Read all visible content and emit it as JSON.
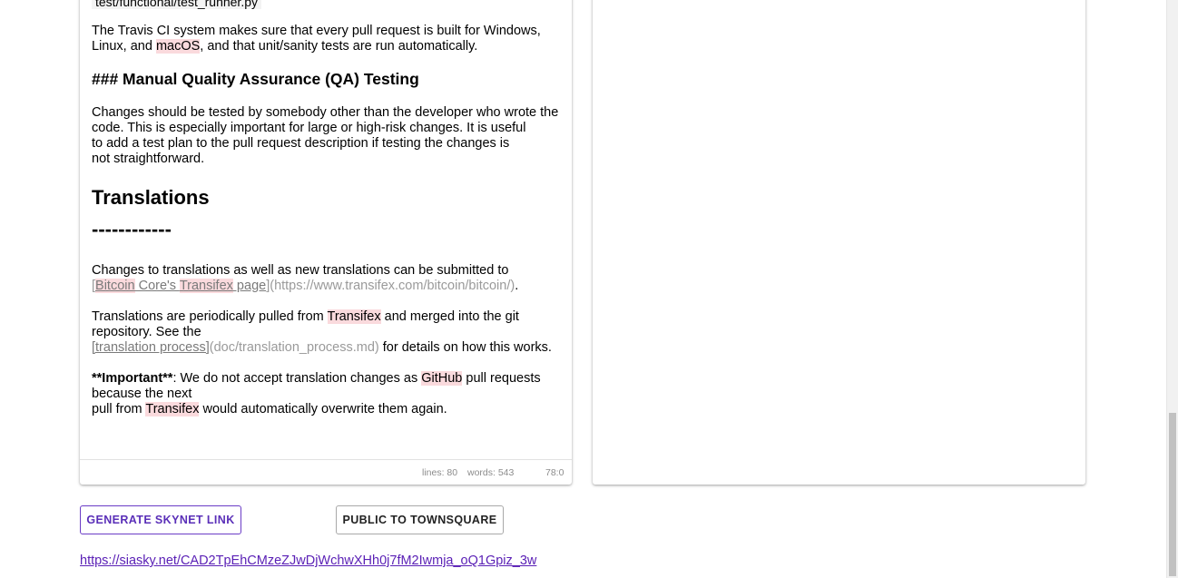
{
  "editor": {
    "code_line": "test/functional/test_runner.py",
    "travis_para": {
      "line1": "The Travis CI system makes sure that every pull request is built for Windows,",
      "line2_a": "Linux, and ",
      "line2_mis": "macOS",
      "line2_b": ", and that unit/sanity tests are run automatically."
    },
    "qa_heading": "### Manual Quality Assurance (QA) Testing",
    "qa_para": [
      "Changes should be tested by somebody other than the developer who wrote the",
      "code. This is especially important for large or high-risk changes. It is useful",
      "to add a test plan to the pull request description if testing the changes is",
      "not straightforward."
    ],
    "translations_heading": "Translations",
    "translations_rule": "------------",
    "trans_para1": {
      "line1": "Changes to translations as well as new translations can be submitted to",
      "bracket_open": "[",
      "link_mis1": "Bitcoin",
      "link_mid": " Core's ",
      "link_mis2": "Transifex",
      "link_end": " page",
      "bracket_close": "]",
      "url": "(https://www.transifex.com/bitcoin/bitcoin/)",
      "period": "."
    },
    "trans_para2": {
      "a": "Translations are periodically pulled from ",
      "mis": "Transifex",
      "b": " and merged into the git",
      "line2": "repository. See the",
      "link_text": "[translation process]",
      "link_url": "(doc/translation_process.md)",
      "tail": " for details on how this works."
    },
    "trans_para3": {
      "bold": "**Important**",
      "a": ": We do not accept translation changes as ",
      "mis1": "GitHub",
      "b": " pull requests",
      "line2": "because the next",
      "c": "pull from ",
      "mis2": "Transifex",
      "d": " would automatically overwrite them again."
    }
  },
  "status_bar": {
    "lines": "lines: 80",
    "words": "words: 543",
    "cursor": "78:0"
  },
  "buttons": {
    "skynet": "GENERATE SKYNET LINK",
    "townsquare": "PUBLIC TO TOWNSQUARE"
  },
  "skylink": "https://siasky.net/CAD2TpEhCMzeZJwDjWchwXHh0j7fM2Iwmja_oQ1Gpiz_3w",
  "colors": {
    "accent": "#5b21b6",
    "misspell_bg": "#fadadd"
  }
}
